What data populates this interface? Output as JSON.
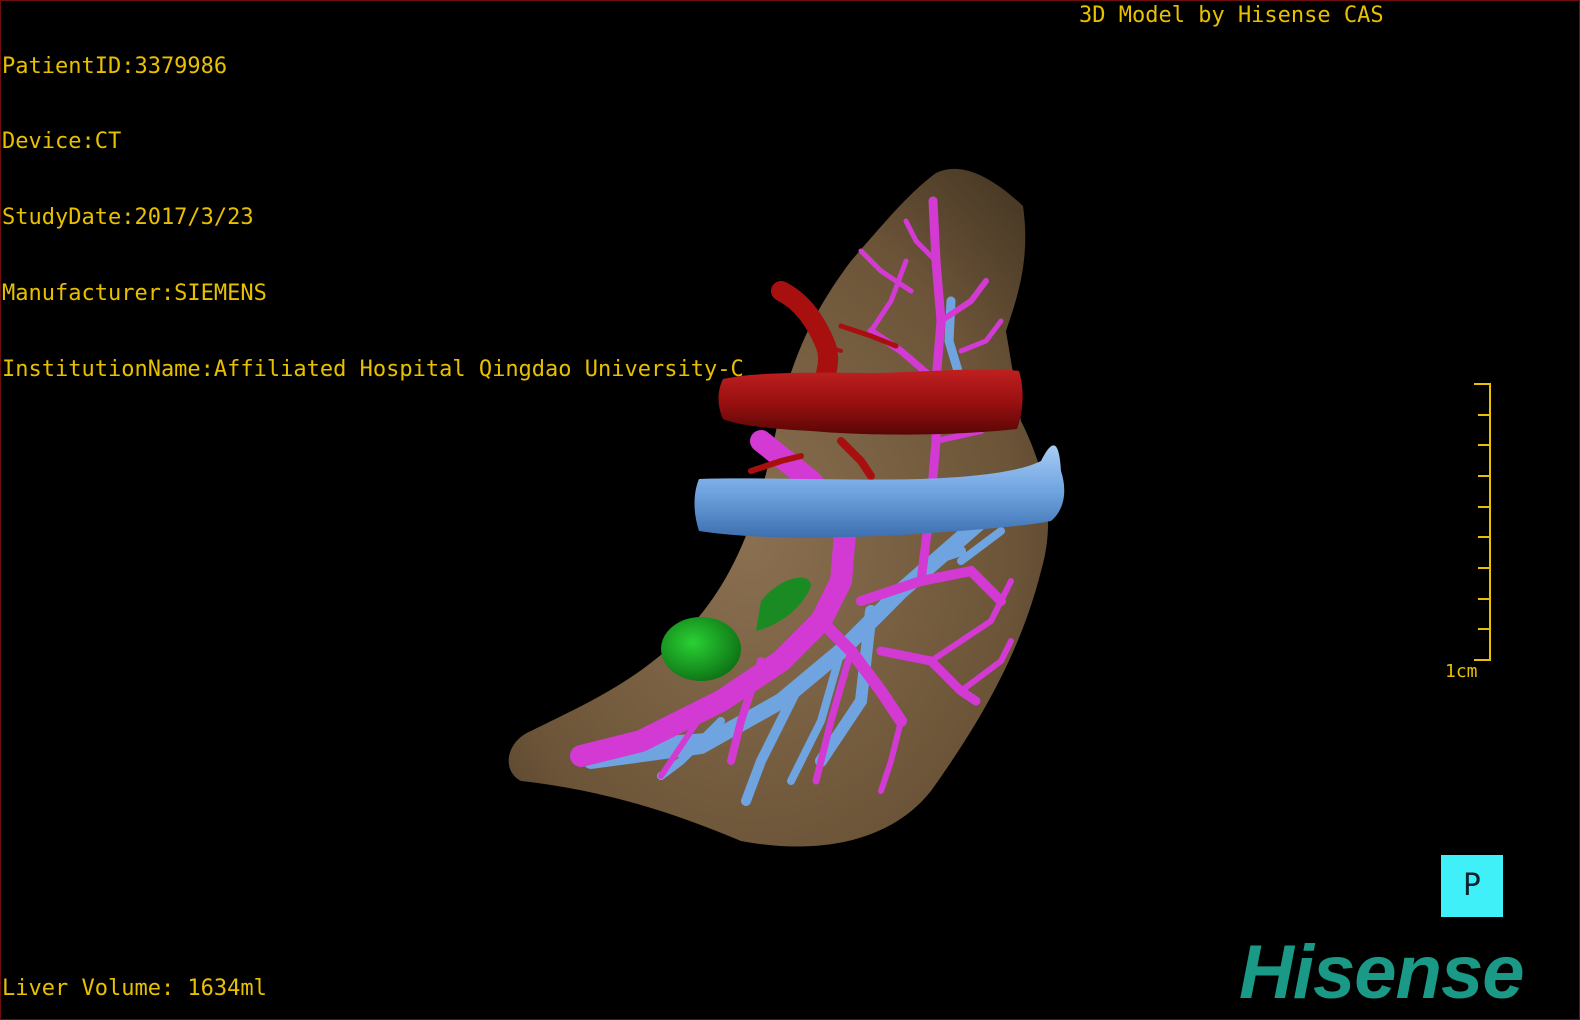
{
  "viewer": {
    "patient_id": "PatientID:3379986",
    "device": "Device:CT",
    "study_date": "StudyDate:2017/3/23",
    "manufacturer": "Manufacturer:SIEMENS",
    "institution": "InstitutionName:Affiliated Hospital Qingdao University-C",
    "credit": "3D Model by Hisense CAS",
    "liver_volume": "Liver Volume: 1634ml",
    "scale_label": "1cm",
    "orientation_marker": "P",
    "brand": "Hisense"
  },
  "colors": {
    "overlay_text": "#e8c000",
    "liver": "#7a6040",
    "portal_vein": "#d33ad3",
    "hepatic_vein": "#6fa4e0",
    "artery": "#a81010",
    "lesion": "#149a1e",
    "orientation_box": "#40f0f8",
    "brand": "#1a9a86"
  },
  "icons": [
    "orientation-cube-icon",
    "scale-bar-icon"
  ]
}
